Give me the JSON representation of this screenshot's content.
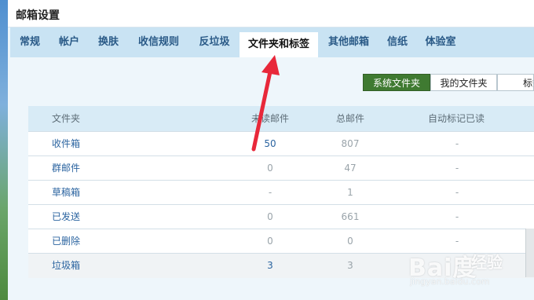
{
  "page": {
    "title": "邮箱设置"
  },
  "tabs": [
    {
      "label": "常规"
    },
    {
      "label": "帐户"
    },
    {
      "label": "换肤"
    },
    {
      "label": "收信规则"
    },
    {
      "label": "反垃圾"
    },
    {
      "label": "文件夹和标签",
      "active": true
    },
    {
      "label": "其他邮箱"
    },
    {
      "label": "信纸"
    },
    {
      "label": "体验室"
    }
  ],
  "subtabs": [
    {
      "label": "系统文件夹",
      "active": true
    },
    {
      "label": "我的文件夹"
    },
    {
      "label": "标签"
    }
  ],
  "table": {
    "columns": {
      "name": "文件夹",
      "unread": "未读邮件",
      "total": "总邮件",
      "auto_mark": "自动标记已读"
    },
    "rows": [
      {
        "name": "收件箱",
        "unread": "50",
        "total": "807",
        "auto_mark": "-"
      },
      {
        "name": "群邮件",
        "unread": "0",
        "total": "47",
        "auto_mark": "-"
      },
      {
        "name": "草稿箱",
        "unread": "-",
        "total": "1",
        "auto_mark": "-"
      },
      {
        "name": "已发送",
        "unread": "0",
        "total": "661",
        "auto_mark": "-"
      },
      {
        "name": "已删除",
        "unread": "0",
        "total": "0",
        "auto_mark": "-"
      },
      {
        "name": "垃圾箱",
        "unread": "3",
        "total": "3",
        "auto_mark": "-"
      }
    ]
  },
  "watermark": {
    "logo": "Bai度",
    "text": "经验",
    "url": "jingyan.baidu.com"
  },
  "colors": {
    "tab_bar": "#c9e3f3",
    "active_subtab": "#3f7a31",
    "arrow": "#e8283a",
    "link": "#2b64a0"
  }
}
